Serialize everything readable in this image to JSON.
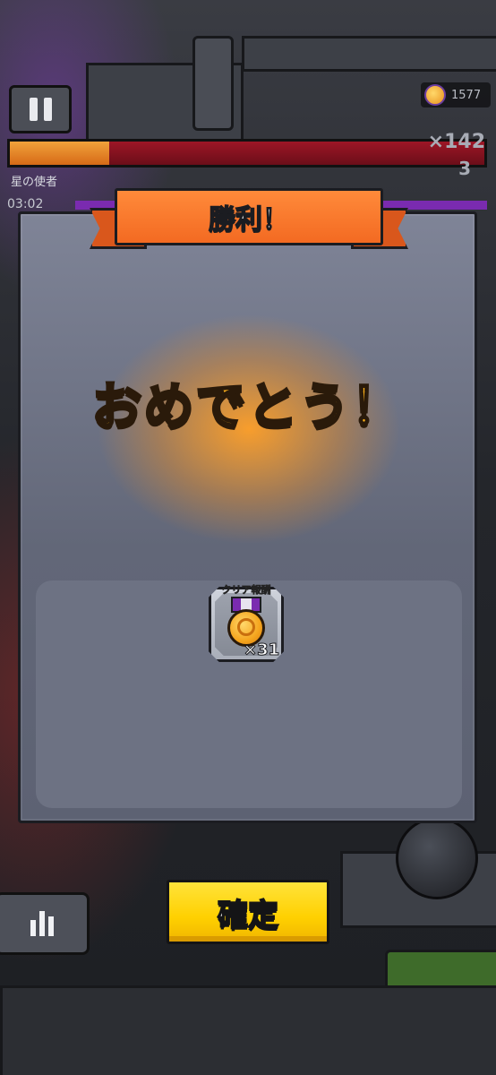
{
  "hud": {
    "coin_count": "1577",
    "boss_hp_multiplier": "×142",
    "boss_hp_level": "3",
    "boss_name": "星の使者",
    "timer": "03:02",
    "boss_hp_fraction": 0.21
  },
  "dialog": {
    "title": "勝利！",
    "message": "おめでとう！",
    "reward": {
      "label": "クリア報酬",
      "count": "×31",
      "icon": "medal-icon"
    }
  },
  "actions": {
    "confirm_label": "確定",
    "stats_icon": "bar-chart-icon"
  },
  "colors": {
    "banner": "#f36a22",
    "confirm": "#ffd000",
    "congrats_text": "#ffb21a"
  }
}
